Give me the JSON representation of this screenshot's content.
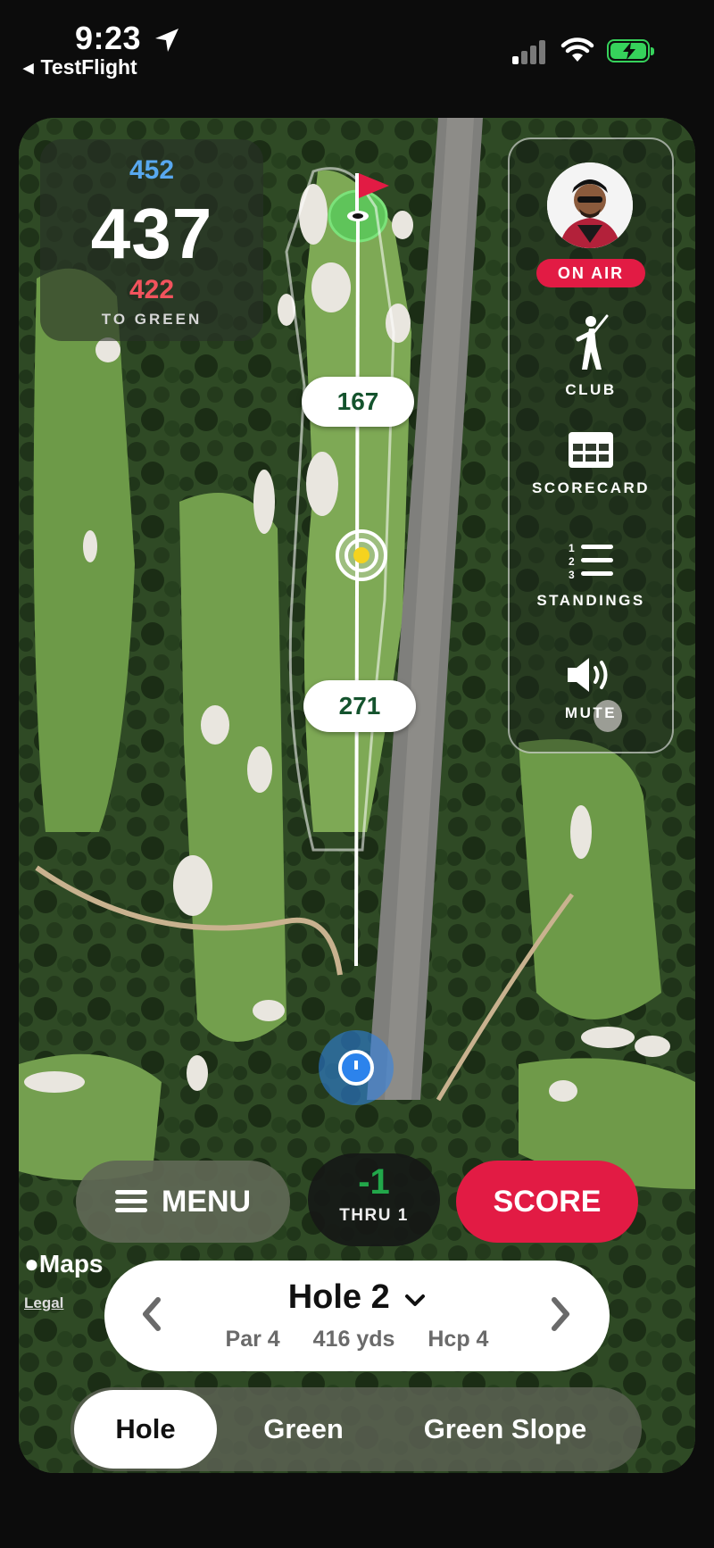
{
  "status_bar": {
    "time": "9:23",
    "back_app": "TestFlight"
  },
  "distance": {
    "back": "452",
    "center": "437",
    "front": "422",
    "label": "TO GREEN"
  },
  "layup_pills": [
    "167",
    "271"
  ],
  "side_panel": {
    "on_air": "ON AIR",
    "items": [
      {
        "label": "CLUB",
        "icon": "golfer-icon"
      },
      {
        "label": "SCORECARD",
        "icon": "scorecard-icon"
      },
      {
        "label": "STANDINGS",
        "icon": "standings-icon"
      },
      {
        "label": "MUTE",
        "icon": "speaker-icon"
      }
    ]
  },
  "controls": {
    "menu_label": "MENU",
    "score_value": "-1",
    "thru_label": "THRU 1",
    "score_label": "SCORE"
  },
  "map_attribution": {
    "maps": "Maps",
    "legal": "Legal"
  },
  "hole": {
    "title": "Hole 2",
    "par": "Par 4",
    "yards": "416 yds",
    "hcp": "Hcp 4"
  },
  "tabs": [
    "Hole",
    "Green",
    "Green Slope"
  ],
  "active_tab": "Hole",
  "colors": {
    "accent_red": "#e21b44",
    "back_blue": "#58a8ef",
    "front_red": "#f2535d",
    "score_green": "#22a74a",
    "pill_text": "#14532d"
  }
}
